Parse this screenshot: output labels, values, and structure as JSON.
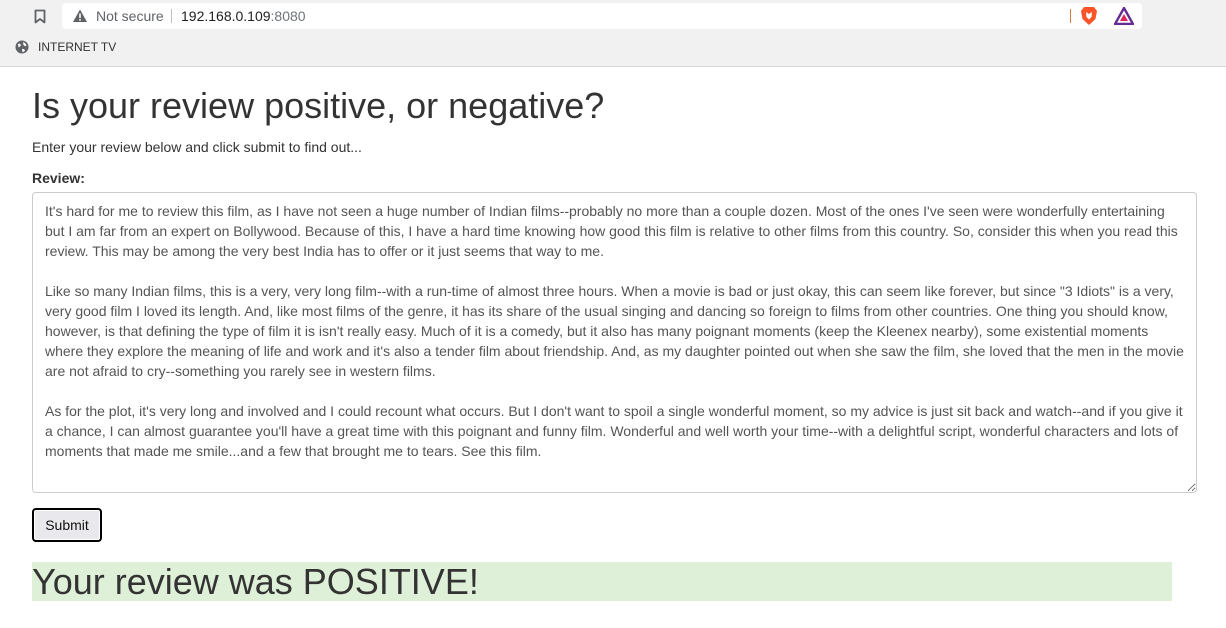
{
  "browser": {
    "security_label": "Not secure",
    "url_host": "192.168.0.109",
    "url_port": ":8080",
    "bookmarks": [
      {
        "label": "INTERNET TV",
        "icon": "globe-icon"
      }
    ],
    "icons": [
      "bookmark-icon",
      "warning-icon",
      "brave-shield-icon",
      "brave-rewards-icon"
    ]
  },
  "page": {
    "title": "Is your review positive, or negative?",
    "subtitle": "Enter your review below and click submit to find out...",
    "review_label": "Review:",
    "review_text": "It's hard for me to review this film, as I have not seen a huge number of Indian films--probably no more than a couple dozen. Most of the ones I've seen were wonderfully entertaining but I am far from an expert on Bollywood. Because of this, I have a hard time knowing how good this film is relative to other films from this country. So, consider this when you read this review. This may be among the very best India has to offer or it just seems that way to me.\n\nLike so many Indian films, this is a very, very long film--with a run-time of almost three hours. When a movie is bad or just okay, this can seem like forever, but since \"3 Idiots\" is a very, very good film I loved its length. And, like most films of the genre, it has its share of the usual singing and dancing so foreign to films from other countries. One thing you should know, however, is that defining the type of film it is isn't really easy. Much of it is a comedy, but it also has many poignant moments (keep the Kleenex nearby), some existential moments where they explore the meaning of life and work and it's also a tender film about friendship. And, as my daughter pointed out when she saw the film, she loved that the men in the movie are not afraid to cry--something you rarely see in western films.\n\nAs for the plot, it's very long and involved and I could recount what occurs. But I don't want to spoil a single wonderful moment, so my advice is just sit back and watch--and if you give it a chance, I can almost guarantee you'll have a great time with this poignant and funny film. Wonderful and well worth your time--with a delightful script, wonderful characters and lots of moments that made me smile...and a few that brought me to tears. See this film.",
    "submit_label": "Submit",
    "result_text": "Your review was POSITIVE!"
  },
  "colors": {
    "result_background": "#dff0d8",
    "text": "#333333",
    "chrome_background": "#f1f1f1"
  }
}
